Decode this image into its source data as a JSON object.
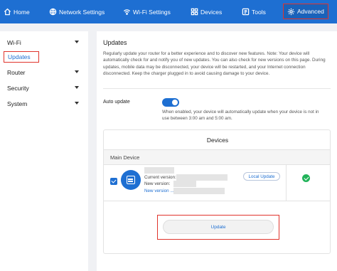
{
  "nav": {
    "items": [
      {
        "label": "Home",
        "icon": "home-icon"
      },
      {
        "label": "Network Settings",
        "icon": "network-icon"
      },
      {
        "label": "Wi-Fi Settings",
        "icon": "wifi-icon"
      },
      {
        "label": "Devices",
        "icon": "devices-icon"
      },
      {
        "label": "Tools",
        "icon": "tools-icon"
      },
      {
        "label": "Advanced",
        "icon": "gear-icon",
        "active": true
      }
    ],
    "accent": "#1e6fd2",
    "highlight": "#e0342c"
  },
  "sidebar": {
    "groups": [
      {
        "label": "Wi-Fi",
        "expanded": true,
        "items": [
          "Updates"
        ]
      },
      {
        "label": "Router"
      },
      {
        "label": "Security"
      },
      {
        "label": "System"
      }
    ],
    "selected": "Updates"
  },
  "main": {
    "title": "Updates",
    "description": "Regularly update your router for a better experience and to discover new features. Note: Your device will automatically check for and notify you of new updates. You can also check for new versions on this page. During updates, mobile data may be disconnected, your device will be restarted, and your Internet connection disconnected. Keep the charger plugged in to avoid causing damage to your device.",
    "auto_update": {
      "label": "Auto update",
      "enabled": true,
      "description": "When enabled, your device will automatically update when your device is not in use between 3:00 am and 5:00 am."
    },
    "devices": {
      "title": "Devices",
      "section": "Main Device",
      "device": {
        "selected": true,
        "current_version_label": "Current version:",
        "new_version_label": "New version:",
        "new_version_link": "New version ...",
        "local_update_label": "Local Update",
        "status": "ok"
      },
      "update_label": "Update"
    }
  }
}
